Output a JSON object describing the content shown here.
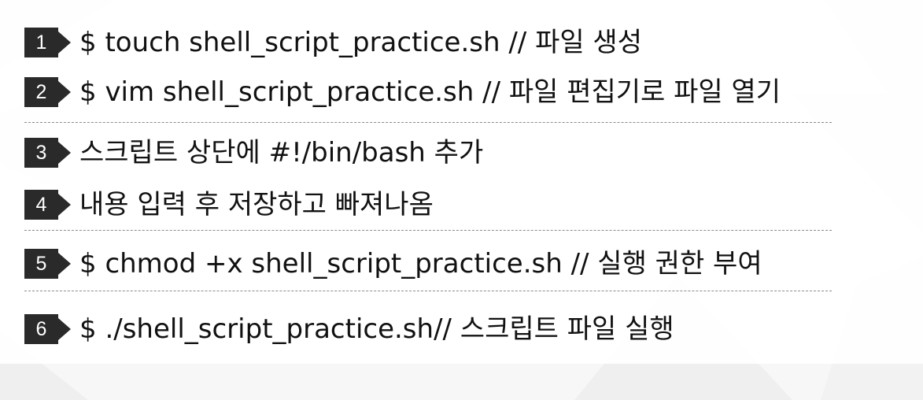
{
  "steps": [
    {
      "number": "1",
      "text": "$ touch shell_script_practice.sh // 파일 생성"
    },
    {
      "number": "2",
      "text": "$ vim shell_script_practice.sh // 파일 편집기로 파일 열기"
    },
    {
      "number": "3",
      "text": "스크립트 상단에 #!/bin/bash 추가"
    },
    {
      "number": "4",
      "text": "내용 입력 후 저장하고 빠져나옴"
    },
    {
      "number": "5",
      "text": "$ chmod +x shell_script_practice.sh // 실행 권한 부여"
    },
    {
      "number": "6",
      "text": "$ ./shell_script_practice.sh// 스크립트 파일 실행"
    }
  ],
  "colors": {
    "badge": "#2a2a2a",
    "text": "#111111",
    "divider": "#8d8d8d",
    "background": "#f7f7f7"
  }
}
